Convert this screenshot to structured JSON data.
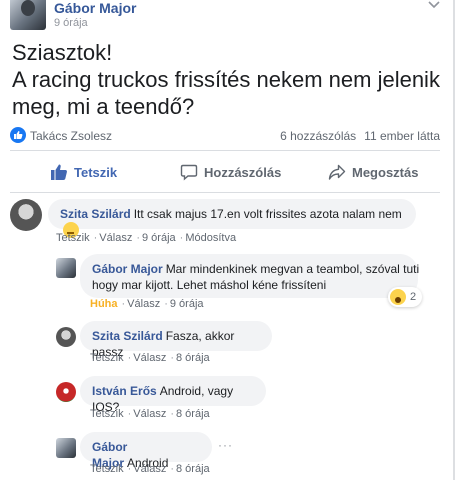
{
  "post": {
    "author": "Gábor Major",
    "time": "9 órája",
    "text_lines": [
      "Sziasztok!",
      "A racing truckos frissítés nekem nem jelenik",
      "meg, mi a teendő?"
    ]
  },
  "reactions": {
    "reactor": "Takács Zsolesz",
    "comments_count": "6 hozzászólás",
    "seen_count": "11 ember látta"
  },
  "actions": {
    "like": "Tetszik",
    "comment": "Hozzászólás",
    "share": "Megosztás"
  },
  "comments": [
    {
      "name": "Szita Szilárd",
      "text": "Itt csak majus 17.en volt frissites azota nalam nem",
      "meta": [
        "Tetszik",
        "Válasz",
        "9 órája",
        "Módosítva"
      ]
    },
    {
      "name": "Gábor Major",
      "text_lines": [
        "Mar mindenkinek megvan a teambol, szóval tuti",
        "hogy mar kijott. Lehet máshol kéne frissíteni"
      ],
      "meta": [
        "Húha",
        "Válasz",
        "9 órája"
      ],
      "reaction_count": "2"
    },
    {
      "name": "Szita Szilárd",
      "text": "Fasza, akkor passz",
      "meta": [
        "Tetszik",
        "Válasz",
        "8 órája"
      ]
    },
    {
      "name": "István Erős",
      "text": "Android, vagy IOS?",
      "meta": [
        "Tetszik",
        "Válasz",
        "8 órája"
      ]
    },
    {
      "name": "Gábor Major",
      "text": "Android",
      "meta": [
        "Tetszik",
        "Válasz",
        "8 órája"
      ],
      "more": "···"
    }
  ],
  "colors": {
    "link": "#365899",
    "like_blue": "#4267b2",
    "bubble": "#f2f3f5",
    "haha": "#f7b125"
  }
}
